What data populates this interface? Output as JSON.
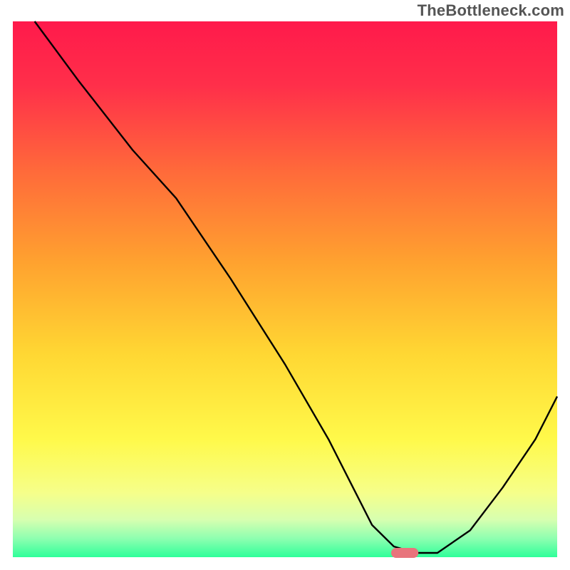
{
  "watermark": "TheBottleneck.com",
  "chart_data": {
    "type": "line",
    "title": "",
    "xlabel": "",
    "ylabel": "",
    "xlim": [
      0,
      100
    ],
    "ylim": [
      0,
      100
    ],
    "grid": false,
    "axes_visible": false,
    "background_gradient": {
      "stops": [
        {
          "offset": 0.0,
          "color": "#ff1a4b"
        },
        {
          "offset": 0.12,
          "color": "#ff2f4a"
        },
        {
          "offset": 0.28,
          "color": "#ff6a3a"
        },
        {
          "offset": 0.45,
          "color": "#ffa22f"
        },
        {
          "offset": 0.62,
          "color": "#ffd733"
        },
        {
          "offset": 0.78,
          "color": "#fff94a"
        },
        {
          "offset": 0.88,
          "color": "#f6ff8a"
        },
        {
          "offset": 0.93,
          "color": "#d7ffb0"
        },
        {
          "offset": 0.965,
          "color": "#8effb0"
        },
        {
          "offset": 1.0,
          "color": "#2fff9a"
        }
      ]
    },
    "curve": {
      "x": [
        4.0,
        12.0,
        22.0,
        30.0,
        40.0,
        50.0,
        58.0,
        63.0,
        66.0,
        70.0,
        74.0,
        78.0,
        84.0,
        90.0,
        96.0,
        100.0
      ],
      "y": [
        100.0,
        89.0,
        76.0,
        67.0,
        52.0,
        36.0,
        22.0,
        12.0,
        6.0,
        2.0,
        0.8,
        0.8,
        5.0,
        13.0,
        22.0,
        30.0
      ]
    },
    "marker": {
      "x": 72.0,
      "y": 0.8,
      "width_pct": 5.0,
      "color": "#e8747c"
    }
  }
}
